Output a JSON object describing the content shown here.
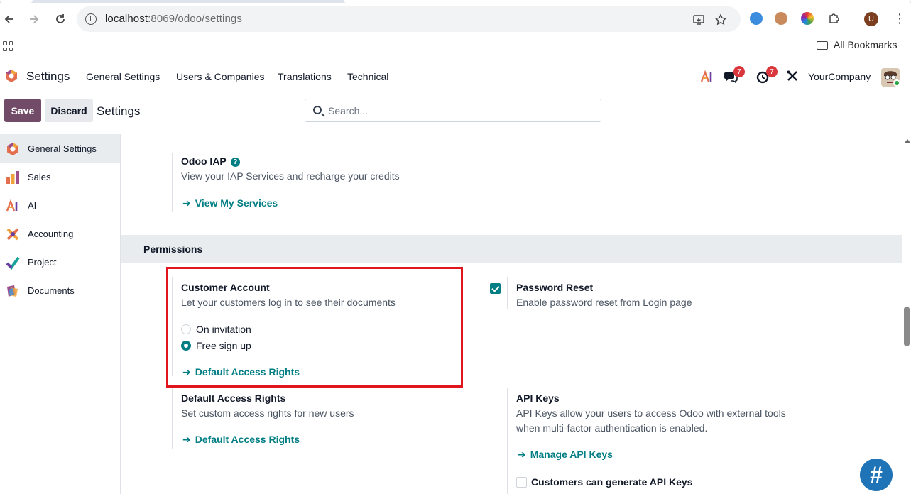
{
  "browser": {
    "url_host": "localhost",
    "url_rest": ":8069/odoo/settings",
    "bookmarks_label": "All Bookmarks",
    "profile_initial": "U"
  },
  "navbar": {
    "app_name": "Settings",
    "menu": [
      "General Settings",
      "Users & Companies",
      "Translations",
      "Technical"
    ],
    "messages_count": "7",
    "activities_count": "7",
    "company": "YourCompany"
  },
  "control_panel": {
    "save_label": "Save",
    "discard_label": "Discard",
    "title": "Settings",
    "search_placeholder": "Search..."
  },
  "sidebar": {
    "items": [
      {
        "label": "General Settings",
        "icon": "odoo-logo-icon",
        "active": true
      },
      {
        "label": "Sales",
        "icon": "sales-icon"
      },
      {
        "label": "AI",
        "icon": "ai-icon"
      },
      {
        "label": "Accounting",
        "icon": "accounting-icon"
      },
      {
        "label": "Project",
        "icon": "project-icon"
      },
      {
        "label": "Documents",
        "icon": "documents-icon"
      }
    ]
  },
  "main": {
    "iap": {
      "title": "Odoo IAP",
      "desc": "View your IAP Services and recharge your credits",
      "link": "View My Services"
    },
    "permissions_header": "Permissions",
    "customer_account": {
      "title": "Customer Account",
      "desc": "Let your customers log in to see their documents",
      "options": [
        "On invitation",
        "Free sign up"
      ],
      "selected": "Free sign up",
      "link": "Default Access Rights"
    },
    "password_reset": {
      "title": "Password Reset",
      "desc": "Enable password reset from Login page",
      "checked": true
    },
    "default_access_rights": {
      "title": "Default Access Rights",
      "desc": "Set custom access rights for new users",
      "link": "Default Access Rights"
    },
    "api_keys": {
      "title": "API Keys",
      "desc_line1": "API Keys allow your users to access Odoo with external tools",
      "desc_line2": "when multi-factor authentication is enabled.",
      "link": "Manage API Keys",
      "customers_generate_label": "Customers can generate API Keys",
      "customers_generate_checked": false
    }
  },
  "floating": {
    "hash_label": "#"
  },
  "colors": {
    "primary": "#714b67",
    "link": "#017e84",
    "highlight": "#e0151e"
  }
}
